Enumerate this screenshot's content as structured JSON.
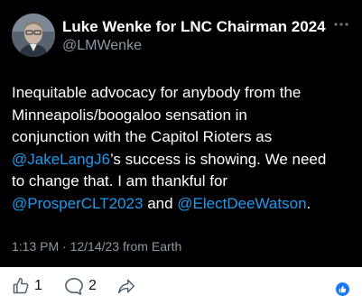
{
  "author": {
    "display_name": "Luke Wenke for LNC Chairman 2024",
    "handle": "@LMWenke"
  },
  "tweet": {
    "lines": [
      [
        {
          "text": "Inequitable advocacy for anybody from the"
        }
      ],
      [
        {
          "text": "Minneapolis/boogaloo sensation in"
        }
      ],
      [
        {
          "text": "conjunction with the Capitol Rioters as"
        }
      ],
      [
        {
          "text": "@JakeLangJ6",
          "mention": true
        },
        {
          "text": "’s success is showing.  We need"
        }
      ],
      [
        {
          "text": "to change that.  I am thankful for"
        }
      ],
      [
        {
          "text": "@ProsperCLT2023",
          "mention": true
        },
        {
          "text": " and "
        },
        {
          "text": "@ElectDeeWatson",
          "mention": true
        },
        {
          "text": "."
        }
      ]
    ]
  },
  "meta": {
    "timestamp": "1:13 PM · 12/14/23 from Earth"
  },
  "actions": {
    "like_count": "1",
    "reply_count": "2"
  },
  "icons": {
    "more": "more-dots-icon",
    "like": "thumbs-up-icon",
    "reply": "comment-bubble-icon",
    "share": "share-arrow-icon",
    "reaction": "like-reaction-badge-icon"
  },
  "colors": {
    "background": "#000000",
    "text": "#ffffff",
    "secondary": "#8b98a5",
    "link": "#1d9bf0",
    "reaction": "#1877f2"
  }
}
